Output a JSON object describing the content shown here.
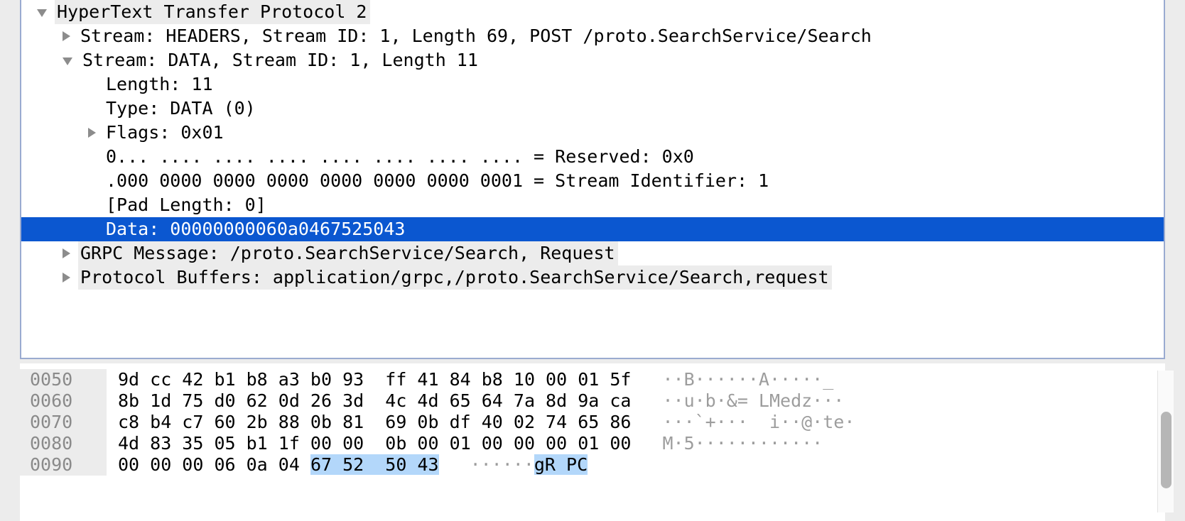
{
  "detail_tree": {
    "rows": [
      {
        "twisty": "open",
        "indent": 0,
        "text": "HyperText Transfer Protocol 2",
        "style": "gray"
      },
      {
        "twisty": "closed",
        "indent": 1,
        "text": "Stream: HEADERS, Stream ID: 1, Length 69, POST /proto.SearchService/Search",
        "style": "plain"
      },
      {
        "twisty": "open",
        "indent": 1,
        "text": "Stream: DATA, Stream ID: 1, Length 11",
        "style": "plain"
      },
      {
        "twisty": "none",
        "indent": 2,
        "text": "Length: 11",
        "style": "plain"
      },
      {
        "twisty": "none",
        "indent": 2,
        "text": "Type: DATA (0)",
        "style": "plain"
      },
      {
        "twisty": "closed",
        "indent": 2,
        "text": "Flags: 0x01",
        "style": "plain"
      },
      {
        "twisty": "none",
        "indent": 2,
        "text": "0... .... .... .... .... .... .... .... = Reserved: 0x0",
        "style": "plain"
      },
      {
        "twisty": "none",
        "indent": 2,
        "text": ".000 0000 0000 0000 0000 0000 0000 0001 = Stream Identifier: 1",
        "style": "plain"
      },
      {
        "twisty": "none",
        "indent": 2,
        "text": "[Pad Length: 0]",
        "style": "plain"
      },
      {
        "twisty": "none",
        "indent": 2,
        "text": "Data: 00000000060a0467525043",
        "style": "selected"
      },
      {
        "twisty": "closed",
        "indent": 1,
        "text": "GRPC Message: /proto.SearchService/Search, Request",
        "style": "gray"
      },
      {
        "twisty": "closed",
        "indent": 1,
        "text": "Protocol Buffers: application/grpc,/proto.SearchService/Search,request",
        "style": "gray"
      }
    ]
  },
  "bytes_pane": {
    "rows": [
      {
        "offset": "0050",
        "hex_pre": "9d cc 42 b1 b8 a3 b0 93  ff 41 84 b8 10 00 01 5f",
        "hex_hl": "",
        "hex_post": "",
        "ascii_pre": "··B······A·····_",
        "ascii_hl": "",
        "ascii_post": ""
      },
      {
        "offset": "0060",
        "hex_pre": "8b 1d 75 d0 62 0d 26 3d  4c 4d 65 64 7a 8d 9a ca",
        "hex_hl": "",
        "hex_post": "",
        "ascii_pre": "··u·b·&= LMedz···",
        "ascii_hl": "",
        "ascii_post": ""
      },
      {
        "offset": "0070",
        "hex_pre": "c8 b4 c7 60 2b 88 0b 81  69 0b df 40 02 74 65 86",
        "hex_hl": "",
        "hex_post": "",
        "ascii_pre": "···`+···  i··@·te·",
        "ascii_hl": "",
        "ascii_post": ""
      },
      {
        "offset": "0080",
        "hex_pre": "4d 83 35 05 b1 1f 00 00  0b 00 01 00 00 00 01 00",
        "hex_hl": "",
        "hex_post": "",
        "ascii_pre": "M·5············",
        "ascii_hl": "",
        "ascii_post": ""
      },
      {
        "offset": "0090",
        "hex_pre": "00 00 00 06 0a 04 ",
        "hex_hl": "67 52  50 43",
        "hex_post": "",
        "ascii_pre": "······",
        "ascii_hl": "gR PC",
        "ascii_post": ""
      }
    ]
  },
  "scrollbar": {
    "name": "bytes-pane-vertical-scrollbar"
  }
}
